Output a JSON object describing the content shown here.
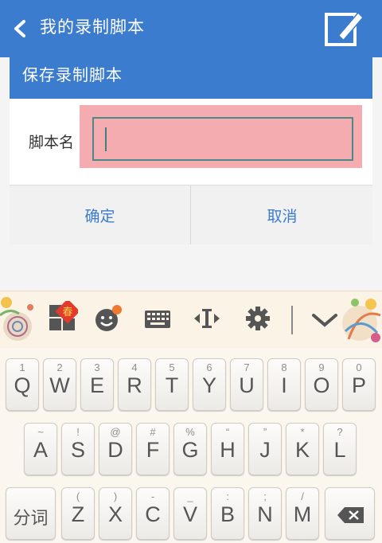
{
  "appbar": {
    "title": "我的录制脚本",
    "back_icon": "chevron-left-icon",
    "edit_icon": "edit-note-icon"
  },
  "dialog": {
    "title": "保存录制脚本",
    "field_label": "脚本名",
    "field_value": "",
    "ok_label": "确定",
    "cancel_label": "取消"
  },
  "keyboard_toolbar": {
    "icons": [
      "spring-festival-icon",
      "emoji-icon",
      "keyboard-icon",
      "cursor-move-icon",
      "settings-icon",
      "hide-keyboard-icon"
    ]
  },
  "keyboard": {
    "row1": [
      {
        "sub": "1",
        "main": "Q"
      },
      {
        "sub": "2",
        "main": "W"
      },
      {
        "sub": "3",
        "main": "E"
      },
      {
        "sub": "4",
        "main": "R"
      },
      {
        "sub": "5",
        "main": "T"
      },
      {
        "sub": "6",
        "main": "Y"
      },
      {
        "sub": "7",
        "main": "U"
      },
      {
        "sub": "8",
        "main": "I"
      },
      {
        "sub": "9",
        "main": "O"
      },
      {
        "sub": "0",
        "main": "P"
      }
    ],
    "row2": [
      {
        "sub": "~",
        "main": "A"
      },
      {
        "sub": "!",
        "main": "S"
      },
      {
        "sub": "@",
        "main": "D"
      },
      {
        "sub": "#",
        "main": "F"
      },
      {
        "sub": "%",
        "main": "G"
      },
      {
        "sub": "“",
        "main": "H"
      },
      {
        "sub": "”",
        "main": "J"
      },
      {
        "sub": "*",
        "main": "K"
      },
      {
        "sub": "?",
        "main": "L"
      }
    ],
    "row3_left": "分词",
    "row3": [
      {
        "sub": "(",
        "main": "Z"
      },
      {
        "sub": ")",
        "main": "X"
      },
      {
        "sub": "-",
        "main": "C"
      },
      {
        "sub": "_",
        "main": "V"
      },
      {
        "sub": ":",
        "main": "B"
      },
      {
        "sub": ";",
        "main": "N"
      },
      {
        "sub": "/",
        "main": "M"
      }
    ],
    "backspace_icon": "backspace-icon"
  }
}
